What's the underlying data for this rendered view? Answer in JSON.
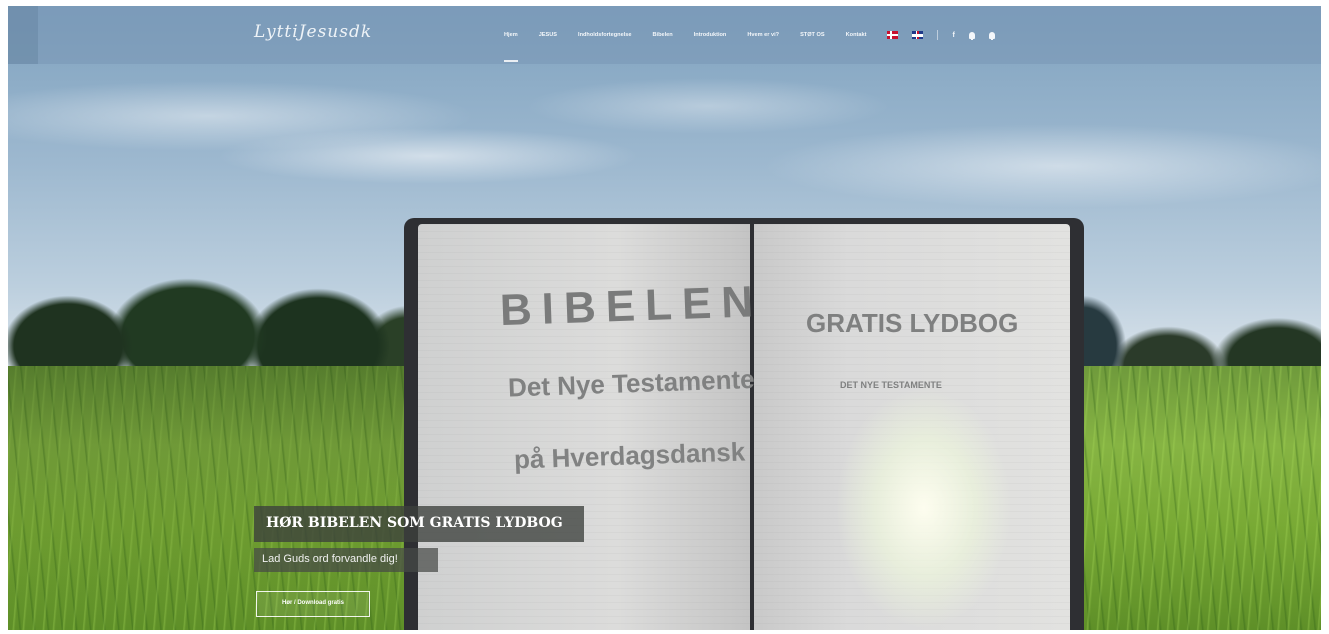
{
  "header": {
    "logo": "LyttiJesusdk",
    "nav": [
      {
        "label": "Hjem",
        "active": true
      },
      {
        "label": "JESUS"
      },
      {
        "label": "Indholdsfortegnelse"
      },
      {
        "label": "Bibelen"
      },
      {
        "label": "Introduktion"
      },
      {
        "label": "Hvem er vi?"
      },
      {
        "label": "STØT OS"
      },
      {
        "label": "Kontakt"
      }
    ],
    "icons": {
      "flag_da": "danish-flag-icon",
      "flag_en": "uk-flag-icon",
      "facebook": "f"
    }
  },
  "hero": {
    "book_left_title": "BIBELEN",
    "book_left_line1": "Det Nye Testamente",
    "book_left_line2": "på Hverdagsdansk",
    "book_right_title": "GRATIS LYDBOG",
    "book_right_sub": "DET NYE TESTAMENTE",
    "caption_title": "HØR BIBELEN SOM GRATIS LYDBOG",
    "caption_sub": "Lad Guds ord forvandle dig!",
    "cta_label": "Hør / Download gratis"
  },
  "colors": {
    "navbar": "#7896b4",
    "caption_bg": "#3c403c",
    "grass": "#86b443"
  }
}
